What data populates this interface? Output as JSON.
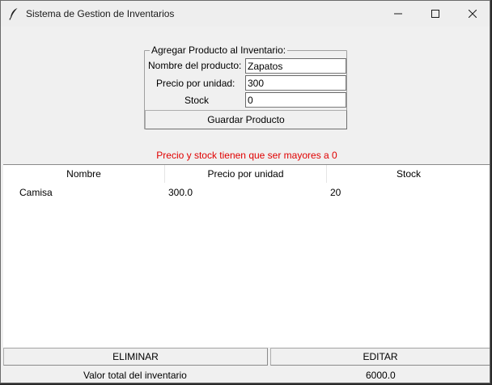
{
  "window": {
    "title": "Sistema de Gestion de Inventarios",
    "icon": "feather-icon"
  },
  "form": {
    "legend": "Agregar Producto al Inventario:",
    "name_label": "Nombre del producto:",
    "name_value": "Zapatos",
    "price_label": "Precio por unidad:",
    "price_value": "300",
    "stock_label": "Stock",
    "stock_value": "0",
    "save_label": "Guardar Producto"
  },
  "error": {
    "message": "Precio y stock tienen que ser mayores a 0",
    "color": "#e00000"
  },
  "table": {
    "columns": [
      "Nombre",
      "Precio por unidad",
      "Stock"
    ],
    "rows": [
      [
        "Camisa",
        "300.0",
        "20"
      ]
    ]
  },
  "actions": {
    "delete_label": "ELIMINAR",
    "edit_label": "EDITAR"
  },
  "footer": {
    "total_label": "Valor total del inventario",
    "total_value": "6000.0"
  }
}
